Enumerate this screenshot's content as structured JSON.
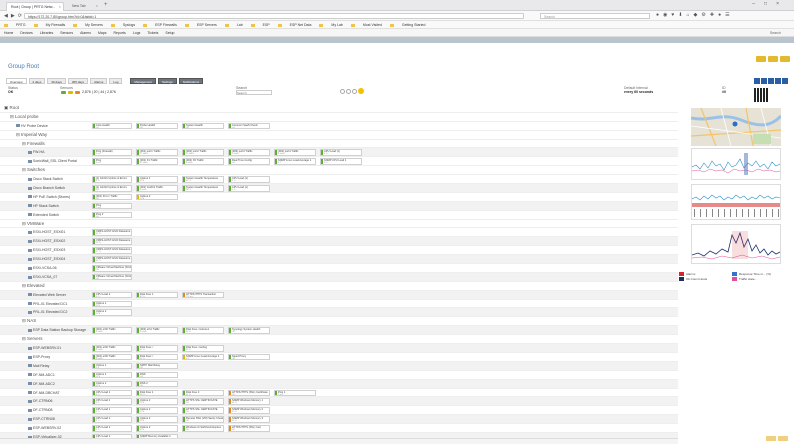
{
  "browser": {
    "active_tab": "Root | Group | PRTG Netw...",
    "other_tab": "New Tab",
    "url": "https://172.20.7.80/group.htm?id=0&tabid=1",
    "search_placeholder": "Search",
    "bookmarks": [
      "PRTG",
      "My Firewalls",
      "My Servers",
      "Syslogs",
      "ESP Firewalls",
      "ESP Servers",
      "Lab",
      "ESP",
      "ESP Net Data",
      "My Lab",
      "Most Visited",
      "Getting Started"
    ]
  },
  "menu": {
    "items": [
      "Home",
      "Devices",
      "Libraries",
      "Sensors",
      "Alarms",
      "Maps",
      "Reports",
      "Logs",
      "Tickets",
      "Setup"
    ],
    "right": "Search"
  },
  "page": {
    "title": "Group Root",
    "view_tabs": [
      "Overview",
      "2 days",
      "30 days",
      "365 days",
      "Alarms",
      "Log"
    ],
    "action_tabs": [
      "Management",
      "Settings",
      "Notifications"
    ],
    "status_label": "Status",
    "status_value": "OK",
    "sensors_label": "Sensors",
    "sensors_summary": "2,876 | 20 | 44 | 2,876",
    "search_label": "Search",
    "search_placeholder": "Search",
    "default_interval_label": "Default Interval",
    "default_interval_value": "every 60 seconds",
    "id_label": "ID",
    "id_value": "#0"
  },
  "tree": [
    {
      "kind": "root",
      "name": "Root",
      "indent": 0
    },
    {
      "kind": "group",
      "name": "Local probe",
      "indent": 1
    },
    {
      "kind": "device",
      "name": "HV Probe Device",
      "indent": 2,
      "sensors": [
        [
          "Core Health",
          "OK"
        ],
        [
          "Probe Health",
          "OK"
        ],
        [
          "System Health",
          "OK"
        ],
        [
          "Common SaaS Check",
          "OK"
        ]
      ],
      "stat": [
        "g",
        "g",
        "g",
        "g"
      ]
    },
    {
      "kind": "group",
      "name": "Imperial Way",
      "indent": 2
    },
    {
      "kind": "group",
      "name": "Firewalls",
      "indent": 3
    },
    {
      "kind": "device",
      "name": "FW-HA",
      "indent": 4,
      "sensors": [
        [
          "Ping (Firewall)",
          "1 ms"
        ],
        [
          "(001) port1 Traffic",
          "72 kbit/s"
        ],
        [
          "(002) port2 Traffic",
          "19 kbit/s"
        ],
        [
          "(003) port3 Traffic",
          "5 kbit/s"
        ],
        [
          "(004) port4 Traffic",
          "0 kbit/s"
        ],
        [
          "CPU Load (1)",
          "4 %"
        ]
      ],
      "stat": [
        "g",
        "g",
        "g",
        "g",
        "g",
        "g"
      ]
    },
    {
      "kind": "device",
      "name": "SonicWall_SSL Client Portal",
      "indent": 4,
      "sensors": [
        [
          "Ping",
          "0 ms"
        ],
        [
          "(001) X1 Traffic",
          "39 kbit/s"
        ],
        [
          "(002) X0 Traffic",
          "0 kbit/s"
        ],
        [
          "Real Time Config",
          "OK"
        ],
        [
          "SNMP Linux Load Average 1",
          "0.1"
        ],
        [
          "SNMP CPU Load 1",
          "3 %"
        ]
      ],
      "stat": [
        "g",
        "g",
        "g",
        "g",
        "g",
        "g"
      ]
    },
    {
      "kind": "group",
      "name": "Switches",
      "indent": 3
    },
    {
      "kind": "device",
      "name": "Cisco Stack Switch",
      "indent": 4,
      "sensors": [
        [
          "(1) G1/0/1 Uptime & Errors",
          "3 %"
        ],
        [
          "Uptime 1",
          "45 d"
        ],
        [
          "System Health Temperature",
          "41 °C"
        ],
        [
          "CPU Load (1)",
          "2 %"
        ]
      ],
      "stat": [
        "g",
        "g",
        "g",
        "g"
      ]
    },
    {
      "kind": "device",
      "name": "Cisco Branch Switch",
      "indent": 4,
      "sensors": [
        [
          "(1) G1/0/2 Uptime & Errors",
          "OK"
        ],
        [
          "(001) Gi1/0/1 Traffic",
          "2 kbit/s"
        ],
        [
          "System Health Temperature",
          "38 °C"
        ],
        [
          "CPU Load (1)",
          "1 %"
        ]
      ],
      "stat": [
        "g",
        "g",
        "g",
        "g"
      ]
    },
    {
      "kind": "device",
      "name": "HP PoE Switch (Stores)",
      "indent": 4,
      "sensors": [
        [
          "(001) Port 1 Traffic",
          "OK"
        ],
        [
          "Uptime 2",
          "12 d"
        ]
      ],
      "stat": [
        "g",
        "y"
      ]
    },
    {
      "kind": "device",
      "name": "HP Stack Switch",
      "indent": 4,
      "sensors": [
        [
          "Ping",
          "1 ms"
        ]
      ],
      "stat": [
        "g"
      ]
    },
    {
      "kind": "device",
      "name": "Extended Switch",
      "indent": 4,
      "sensors": [
        [
          "Ping 2",
          "OK"
        ]
      ],
      "stat": [
        "g"
      ]
    },
    {
      "kind": "group",
      "name": "VMWare",
      "indent": 3
    },
    {
      "kind": "device",
      "name": "ESXi-HOST_ESXi01",
      "indent": 4,
      "sensors": [
        [
          "VMFS-HOST: ESXI Datastore Free",
          "62 %"
        ]
      ],
      "stat": [
        "g"
      ]
    },
    {
      "kind": "device",
      "name": "ESXi-HOST_ESXi02",
      "indent": 4,
      "sensors": [
        [
          "VMFS-HOST: ESXI Datastore Free",
          "58 %"
        ]
      ],
      "stat": [
        "g"
      ]
    },
    {
      "kind": "device",
      "name": "ESXi-HOST_ESXi03",
      "indent": 4,
      "sensors": [
        [
          "VMFS-HOST: ESXI Datastore Free",
          "71 %"
        ]
      ],
      "stat": [
        "g"
      ]
    },
    {
      "kind": "device",
      "name": "ESXi-HOST_ESXi04",
      "indent": 4,
      "sensors": [
        [
          "VMFS-HOST: ESXI Datastore Free",
          "44 %"
        ]
      ],
      "stat": [
        "g"
      ]
    },
    {
      "kind": "device",
      "name": "ESXi-VCSA-06",
      "indent": 4,
      "sensors": [
        [
          "VMware Virtual Machine (SOAP)",
          "OK"
        ]
      ],
      "stat": [
        "g"
      ]
    },
    {
      "kind": "device",
      "name": "ESXi-VCSA_07",
      "indent": 4,
      "sensors": [
        [
          "VMware Virtual Machine (SOAP)",
          "OK"
        ]
      ],
      "stat": [
        "g"
      ]
    },
    {
      "kind": "group",
      "name": "Elevated",
      "indent": 3
    },
    {
      "kind": "device",
      "name": "Elevated Web Server",
      "indent": 4,
      "sensors": [
        [
          "CPU Load 1",
          "4 %"
        ],
        [
          "Disk Free 1",
          "62 %"
        ],
        [
          "HTTP/HTTPS Transaction",
          "123 ms"
        ]
      ],
      "stat": [
        "g",
        "g",
        "o"
      ]
    },
    {
      "kind": "device",
      "name": "PRL-01 Elevated DC1",
      "indent": 4,
      "sensors": [
        [
          "Uptime 1",
          "12 d"
        ]
      ],
      "stat": [
        "g"
      ]
    },
    {
      "kind": "device",
      "name": "PRL-01 Elevated DC2",
      "indent": 4,
      "sensors": [
        [
          "Uptime 2",
          "12 d"
        ]
      ],
      "stat": [
        "g"
      ]
    },
    {
      "kind": "group",
      "name": "NAS",
      "indent": 3
    },
    {
      "kind": "device",
      "name": "ESP Data Station Backup Storage",
      "indent": 4,
      "sensors": [
        [
          "(001) eth0 Traffic",
          "0 kbit/s"
        ],
        [
          "(002) eth1 Traffic",
          "0 kbit/s"
        ],
        [
          "Disk Free: /volume1",
          "38 %"
        ],
        [
          "Synology System Health",
          "OK"
        ]
      ],
      "stat": [
        "g",
        "g",
        "g",
        "g"
      ]
    },
    {
      "kind": "group",
      "name": "Servers",
      "indent": 3
    },
    {
      "kind": "device",
      "name": "ESP-WEBSRV-01",
      "indent": 4,
      "sensors": [
        [
          "(001) eth0 Traffic",
          "0 kbit/s"
        ],
        [
          "Disk Free: /",
          "47 %"
        ],
        [
          "Disk Free: /var/log",
          "55 %"
        ]
      ],
      "stat": [
        "g",
        "g",
        "g"
      ]
    },
    {
      "kind": "device",
      "name": "ESP-Proxy",
      "indent": 4,
      "sensors": [
        [
          "(001) eth0 Traffic",
          "0 kbit/s"
        ],
        [
          "Disk Free: /",
          "41 %"
        ],
        [
          "SNMP Linux Load Average 1",
          "0.3"
        ],
        [
          "Squid Proxy",
          "OK"
        ]
      ],
      "stat": [
        "g",
        "g",
        "y",
        "g"
      ]
    },
    {
      "kind": "device",
      "name": "Mail Relay",
      "indent": 4,
      "sensors": [
        [
          "Uptime 1",
          "9 d"
        ],
        [
          "SMTP Mail Relay",
          "OK"
        ]
      ],
      "stat": [
        "g",
        "g"
      ]
    },
    {
      "kind": "device",
      "name": "DF-NM-ADC1",
      "indent": 4,
      "sensors": [
        [
          "Uptime 1",
          "14 d"
        ],
        [
          "DNS",
          "OK"
        ]
      ],
      "stat": [
        "g",
        "g"
      ]
    },
    {
      "kind": "device",
      "name": "DF-NM-ADC2",
      "indent": 4,
      "sensors": [
        [
          "Uptime 2",
          "14 d"
        ],
        [
          "DNS 2",
          "OK"
        ]
      ],
      "stat": [
        "g",
        "g"
      ]
    },
    {
      "kind": "device",
      "name": "DF-NM-DBCHAT",
      "indent": 4,
      "sensors": [
        [
          "CPU Load 1",
          "6 %"
        ],
        [
          "Disk Free 1",
          "58 %"
        ],
        [
          "Disk Free 2",
          "61 %"
        ],
        [
          "HTTP/HTTPS (SSL) Certificate",
          "OK"
        ],
        [
          "Ping 1",
          "2 ms"
        ]
      ],
      "stat": [
        "g",
        "g",
        "g",
        "o",
        "g"
      ]
    },
    {
      "kind": "device",
      "name": "DF-CTRN06",
      "indent": 4,
      "sensors": [
        [
          "CPU Load 1",
          "4 %"
        ],
        [
          "Uptime 2",
          "22 d"
        ],
        [
          "HTTPS SSL CERTIFICATE",
          "OK"
        ],
        [
          "SNMP Windows Memory 1",
          "44 %"
        ]
      ],
      "stat": [
        "g",
        "g",
        "g",
        "o"
      ]
    },
    {
      "kind": "device",
      "name": "DF-CTRN08",
      "indent": 4,
      "sensors": [
        [
          "CPU Load 1",
          "3 %"
        ],
        [
          "Uptime 2",
          "22 d"
        ],
        [
          "HTTPS SSL CERTIFICATE",
          "OK"
        ],
        [
          "SNMP Windows Memory 2",
          "39 %"
        ]
      ],
      "stat": [
        "g",
        "g",
        "g",
        "o"
      ]
    },
    {
      "kind": "device",
      "name": "ESP-CTRN08",
      "indent": 4,
      "sensors": [
        [
          "CPU Load 1",
          "5 %"
        ],
        [
          "Uptime 2",
          "18 d"
        ],
        [
          "Remote SSH (VM) Sanity Check",
          "OK"
        ],
        [
          "SNMP Windows Memory 3",
          "52 %"
        ]
      ],
      "stat": [
        "g",
        "g",
        "g",
        "o"
      ]
    },
    {
      "kind": "device",
      "name": "ESP-WEBSRV-02",
      "indent": 4,
      "sensors": [
        [
          "CPU Load 1",
          "2 %"
        ],
        [
          "Uptime 2",
          "31 d"
        ],
        [
          "Windows Ui Selfcheck Expires",
          "OK"
        ],
        [
          "HTTP/HTTPS (SSL) Cert",
          "OK"
        ]
      ],
      "stat": [
        "g",
        "g",
        "g",
        "o"
      ]
    },
    {
      "kind": "device",
      "name": "ESP-Virtualizer-02",
      "indent": 4,
      "sensors": [
        [
          "CPU Load 1",
          "3 %"
        ],
        [
          "SNMP Memory Available 1",
          "61 %"
        ]
      ],
      "stat": [
        "g",
        "g"
      ]
    }
  ],
  "right_panel": {
    "legend": [
      {
        "label": "Alarms",
        "swatch": "#d9232b",
        "right_label": "Response Time in... (%)",
        "right_swatch": "#3a6fd0"
      },
      {
        "label": "Ok Count Hosts",
        "swatch": "#222c5e",
        "right_label": "Traffic state...",
        "right_swatch": "#e14d9c"
      }
    ],
    "chart1_label": "Traffic",
    "chart2_label": "Traffic",
    "chart3_label": "CPU Usage"
  }
}
